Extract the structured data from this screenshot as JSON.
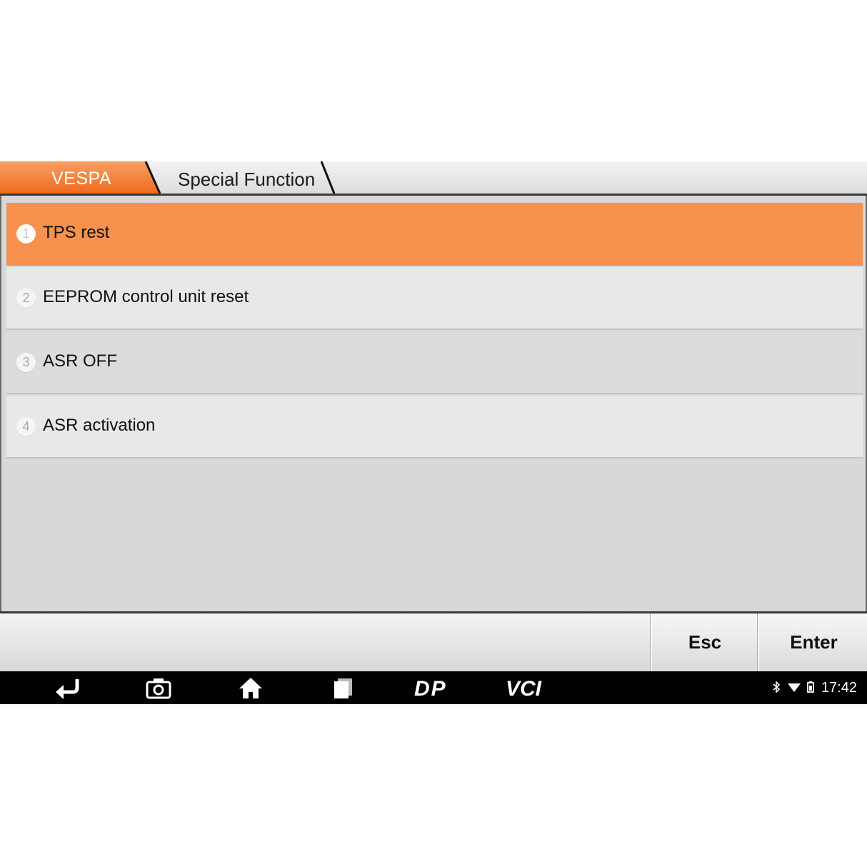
{
  "header": {
    "brand": "VESPA",
    "page_title": "Special Function"
  },
  "menu": {
    "items": [
      {
        "number": "1",
        "label": "TPS rest",
        "selected": true
      },
      {
        "number": "2",
        "label": "EEPROM control unit reset",
        "selected": false
      },
      {
        "number": "3",
        "label": "ASR OFF",
        "selected": false
      },
      {
        "number": "4",
        "label": "ASR activation",
        "selected": false
      }
    ]
  },
  "footer": {
    "esc_label": "Esc",
    "enter_label": "Enter"
  },
  "navbar": {
    "icons": [
      "back-icon",
      "camera-icon",
      "home-icon",
      "recent-apps-icon",
      "dp-icon",
      "vci-icon"
    ],
    "dp_text": "DP",
    "vci_text": "VCI"
  },
  "status": {
    "time": "17:42",
    "icons": [
      "bluetooth-icon",
      "wifi-icon",
      "battery-icon"
    ]
  },
  "colors": {
    "accent": "#f7914d",
    "brand_tab": "#f26d1f",
    "row": "#e8e8e8",
    "row_alt": "#dadcde",
    "background": "#d6d8da",
    "navbar": "#000000"
  }
}
